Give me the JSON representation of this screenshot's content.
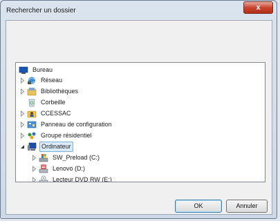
{
  "window": {
    "title": "Rechercher un dossier",
    "close_glyph": "x"
  },
  "tree": {
    "root": {
      "label": "Bureau",
      "icon": "desktop-icon"
    },
    "items": [
      {
        "label": "Réseau",
        "icon": "network-icon",
        "expander": "collapsed"
      },
      {
        "label": "Bibliothèques",
        "icon": "libraries-icon",
        "expander": "collapsed"
      },
      {
        "label": "Corbeille",
        "icon": "recycle-bin-icon",
        "expander": "none"
      },
      {
        "label": "CCESSAC",
        "icon": "user-folder-icon",
        "expander": "collapsed"
      },
      {
        "label": "Panneau de configuration",
        "icon": "control-panel-icon",
        "expander": "collapsed"
      },
      {
        "label": "Groupe résidentiel",
        "icon": "homegroup-icon",
        "expander": "collapsed"
      },
      {
        "label": "Ordinateur",
        "icon": "computer-icon",
        "expander": "expanded",
        "selected": true
      }
    ],
    "children": [
      {
        "label": "SW_Preload (C:)",
        "icon": "system-drive-icon",
        "expander": "collapsed"
      },
      {
        "label": "Lenovo (D:)",
        "icon": "lenovo-drive-icon",
        "expander": "collapsed"
      },
      {
        "label": "Lecteur DVD RW (E:)",
        "icon": "dvd-drive-icon",
        "expander": "collapsed"
      }
    ]
  },
  "buttons": {
    "ok": "OK",
    "cancel": "Annuler"
  }
}
